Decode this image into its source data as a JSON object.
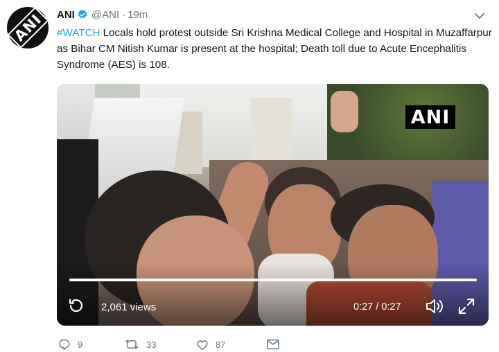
{
  "author": {
    "name": "ANI",
    "handle": "@ANI",
    "separator": "·",
    "time": "19m",
    "avatar_text": "ANI",
    "verified": true
  },
  "tweet": {
    "hashtag": "#WATCH",
    "text": " Locals hold protest outside Sri Krishna Medical College and Hospital in Muzaffarpur as Bihar CM Nitish Kumar is present at the hospital; Death toll due to Acute Encephalitis Syndrome (AES) is 108."
  },
  "video": {
    "watermark": "ANI",
    "views": "2,061 views",
    "time": "0:27 / 0:27",
    "progress": 1.0
  },
  "actions": {
    "replies": "9",
    "retweets": "33",
    "likes": "87"
  },
  "colors": {
    "link": "#1da1f2",
    "muted": "#657786",
    "text": "#14171a",
    "verified": "#1da1f2"
  },
  "icons": [
    "verified-badge-icon",
    "caret-down-icon",
    "replay-icon",
    "volume-icon",
    "fullscreen-icon",
    "reply-icon",
    "retweet-icon",
    "like-icon",
    "message-icon"
  ]
}
